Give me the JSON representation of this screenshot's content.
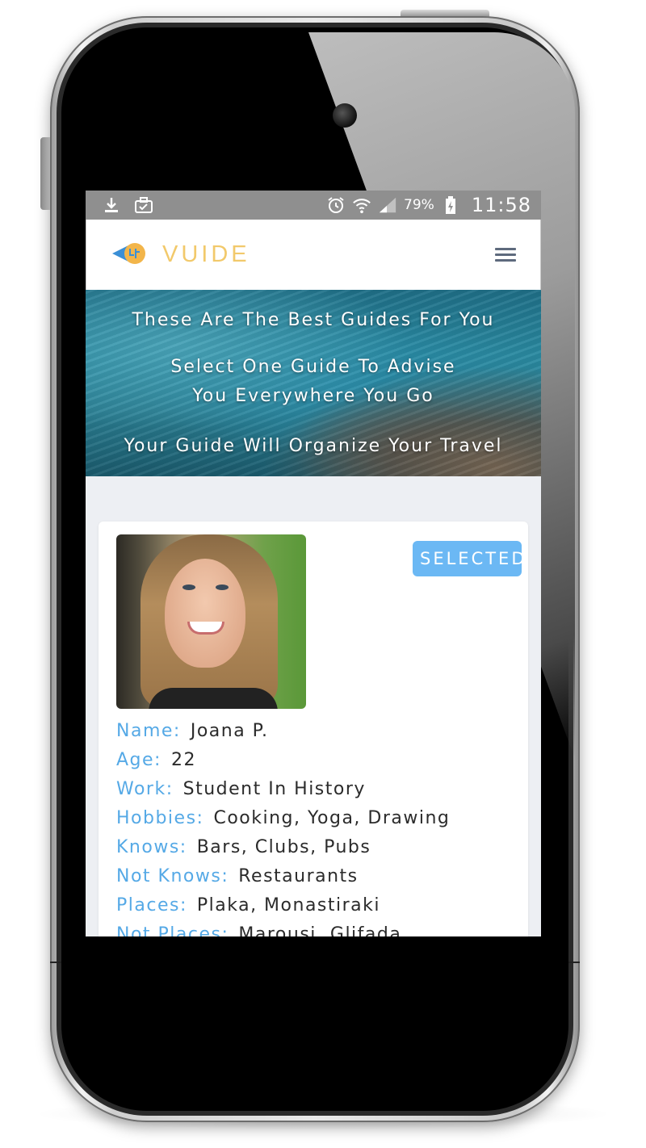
{
  "status_bar": {
    "left_icons": [
      "download-icon",
      "briefcase-check-icon"
    ],
    "right_icons": [
      "alarm-icon",
      "wifi-icon",
      "signal-icon",
      "battery-charging-icon"
    ],
    "battery": "79%",
    "time": "11:58"
  },
  "header": {
    "brand": "VUIDE",
    "logo_icon": "vuide-logo-icon",
    "menu_icon": "hamburger-menu-icon"
  },
  "hero": {
    "line1": "These Are The Best Guides For You",
    "line2": "Select One Guide To Advise You Everywhere You Go",
    "line3": "Your Guide Will Organize Your Travel"
  },
  "guide": {
    "select_label": "SELECTED",
    "fields": [
      {
        "label": "Name:",
        "value": "Joana P."
      },
      {
        "label": "Age:",
        "value": "22"
      },
      {
        "label": "Work:",
        "value": "Student In History"
      },
      {
        "label": "Hobbies:",
        "value": "Cooking, Yoga, Drawing"
      },
      {
        "label": "Knows:",
        "value": "Bars,  Clubs, Pubs"
      },
      {
        "label": "Not Knows:",
        "value": "Restaurants"
      },
      {
        "label": "Places:",
        "value": "Plaka, Monastiraki"
      },
      {
        "label": "Not Places:",
        "value": "Marousi, Glifada"
      }
    ]
  },
  "colors": {
    "brand": "#f2c96b",
    "label": "#55a9e6",
    "select_button": "#6bb8f4",
    "status_bar": "#8f8f8f"
  }
}
